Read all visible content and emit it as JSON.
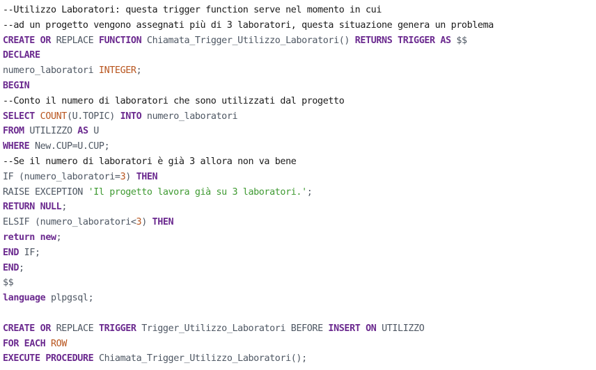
{
  "editor": {
    "background": "#ffffff",
    "colors": {
      "comment": "#1a1a1a",
      "keyword": "#6b2a8f",
      "type": "#b8551e",
      "identifier": "#4e5763",
      "number": "#b8551e",
      "string": "#3f9a32"
    },
    "lines": [
      [
        {
          "t": "comment",
          "v": "--Utilizzo Laboratori: questa trigger function serve nel momento in cui"
        }
      ],
      [
        {
          "t": "comment",
          "v": "--ad un progetto vengono assegnati più di 3 laboratori, questa situazione genera un problema"
        }
      ],
      [
        {
          "t": "kw",
          "v": "CREATE"
        },
        {
          "t": "punct",
          "v": " "
        },
        {
          "t": "kw",
          "v": "OR"
        },
        {
          "t": "ident",
          "v": " REPLACE "
        },
        {
          "t": "kw",
          "v": "FUNCTION"
        },
        {
          "t": "ident",
          "v": " Chiamata_Trigger_Utilizzo_Laboratori() "
        },
        {
          "t": "kw",
          "v": "RETURNS"
        },
        {
          "t": "punct",
          "v": " "
        },
        {
          "t": "kw",
          "v": "TRIGGER"
        },
        {
          "t": "punct",
          "v": " "
        },
        {
          "t": "kw",
          "v": "AS"
        },
        {
          "t": "ident",
          "v": " $$"
        }
      ],
      [
        {
          "t": "kw",
          "v": "DECLARE"
        }
      ],
      [
        {
          "t": "ident",
          "v": "numero_laboratori "
        },
        {
          "t": "type",
          "v": "INTEGER"
        },
        {
          "t": "punct",
          "v": ";"
        }
      ],
      [
        {
          "t": "kw",
          "v": "BEGIN"
        }
      ],
      [
        {
          "t": "comment",
          "v": "--Conto il numero di laboratori che sono utilizzati dal progetto"
        }
      ],
      [
        {
          "t": "kw",
          "v": "SELECT"
        },
        {
          "t": "punct",
          "v": " "
        },
        {
          "t": "type",
          "v": "COUNT"
        },
        {
          "t": "ident",
          "v": "(U.TOPIC) "
        },
        {
          "t": "kw",
          "v": "INTO"
        },
        {
          "t": "ident",
          "v": " numero_laboratori"
        }
      ],
      [
        {
          "t": "kw",
          "v": "FROM"
        },
        {
          "t": "ident",
          "v": " UTILIZZO "
        },
        {
          "t": "kw",
          "v": "AS"
        },
        {
          "t": "ident",
          "v": " U"
        }
      ],
      [
        {
          "t": "kw",
          "v": "WHERE"
        },
        {
          "t": "ident",
          "v": " New.CUP=U.CUP;"
        }
      ],
      [
        {
          "t": "comment",
          "v": "--Se il numero di laboratori è già 3 allora non va bene"
        }
      ],
      [
        {
          "t": "ident",
          "v": "IF (numero_laboratori="
        },
        {
          "t": "num",
          "v": "3"
        },
        {
          "t": "ident",
          "v": ") "
        },
        {
          "t": "kw",
          "v": "THEN"
        }
      ],
      [
        {
          "t": "ident",
          "v": "RAISE EXCEPTION "
        },
        {
          "t": "str",
          "v": "'Il progetto lavora già su 3 laboratori.'"
        },
        {
          "t": "punct",
          "v": ";"
        }
      ],
      [
        {
          "t": "kw",
          "v": "RETURN"
        },
        {
          "t": "punct",
          "v": " "
        },
        {
          "t": "kw",
          "v": "NULL"
        },
        {
          "t": "punct",
          "v": ";"
        }
      ],
      [
        {
          "t": "ident",
          "v": "ELSIF (numero_laboratori<"
        },
        {
          "t": "num",
          "v": "3"
        },
        {
          "t": "ident",
          "v": ") "
        },
        {
          "t": "kw",
          "v": "THEN"
        }
      ],
      [
        {
          "t": "kw",
          "v": "return"
        },
        {
          "t": "punct",
          "v": " "
        },
        {
          "t": "kw",
          "v": "new"
        },
        {
          "t": "punct",
          "v": ";"
        }
      ],
      [
        {
          "t": "kw",
          "v": "END"
        },
        {
          "t": "ident",
          "v": " IF;"
        }
      ],
      [
        {
          "t": "kw",
          "v": "END"
        },
        {
          "t": "punct",
          "v": ";"
        }
      ],
      [
        {
          "t": "ident",
          "v": "$$"
        }
      ],
      [
        {
          "t": "kw",
          "v": "language"
        },
        {
          "t": "ident",
          "v": " plpgsql;"
        }
      ],
      [],
      [
        {
          "t": "kw",
          "v": "CREATE"
        },
        {
          "t": "punct",
          "v": " "
        },
        {
          "t": "kw",
          "v": "OR"
        },
        {
          "t": "ident",
          "v": " REPLACE "
        },
        {
          "t": "kw",
          "v": "TRIGGER"
        },
        {
          "t": "ident",
          "v": " Trigger_Utilizzo_Laboratori BEFORE "
        },
        {
          "t": "kw",
          "v": "INSERT"
        },
        {
          "t": "punct",
          "v": " "
        },
        {
          "t": "kw",
          "v": "ON"
        },
        {
          "t": "ident",
          "v": " UTILIZZO"
        }
      ],
      [
        {
          "t": "kw",
          "v": "FOR"
        },
        {
          "t": "punct",
          "v": " "
        },
        {
          "t": "kw",
          "v": "EACH"
        },
        {
          "t": "punct",
          "v": " "
        },
        {
          "t": "type",
          "v": "ROW"
        }
      ],
      [
        {
          "t": "kw",
          "v": "EXECUTE"
        },
        {
          "t": "punct",
          "v": " "
        },
        {
          "t": "kw",
          "v": "PROCEDURE"
        },
        {
          "t": "ident",
          "v": " Chiamata_Trigger_Utilizzo_Laboratori();"
        }
      ]
    ]
  }
}
